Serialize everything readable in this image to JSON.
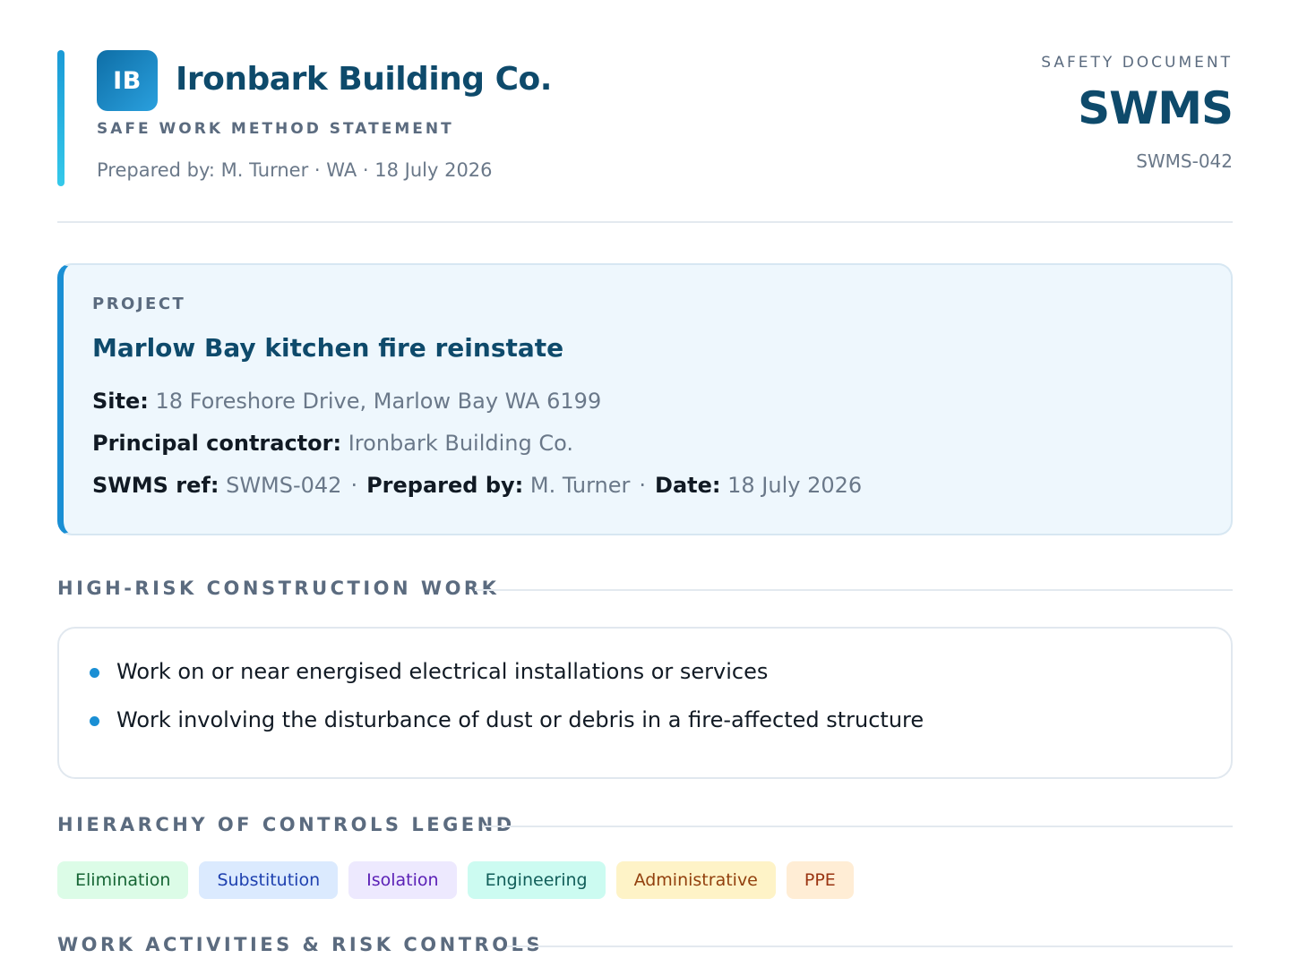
{
  "header": {
    "logo_text": "IB",
    "company_name": "Ironbark Building Co.",
    "subtitle": "SAFE WORK METHOD STATEMENT",
    "prepared_line": "Prepared by: M. Turner · WA · 18 July 2026",
    "doc_type_label": "SAFETY DOCUMENT",
    "doc_type": "SWMS",
    "doc_ref": "SWMS-042"
  },
  "project": {
    "label": "PROJECT",
    "title": "Marlow Bay kitchen fire reinstate",
    "site_label": "Site:",
    "site": "18 Foreshore Drive, Marlow Bay WA 6199",
    "contractor_label": "Principal contractor:",
    "contractor": "Ironbark Building Co.",
    "ref_label": "SWMS ref:",
    "ref": "SWMS-042",
    "prepared_label": "Prepared by:",
    "prepared": "M. Turner",
    "date_label": "Date:",
    "date": "18 July 2026",
    "separator": "·"
  },
  "sections": {
    "hrcw_title": "HIGH-RISK CONSTRUCTION WORK",
    "legend_title": "HIERARCHY OF CONTROLS LEGEND",
    "activities_title": "WORK ACTIVITIES & RISK CONTROLS"
  },
  "hrcw_items": [
    "Work on or near energised electrical installations or services",
    "Work involving the disturbance of dust or debris in a fire-affected structure"
  ],
  "legend": [
    {
      "label": "Elimination",
      "bg": "#dcfce7",
      "fg": "#166534"
    },
    {
      "label": "Substitution",
      "bg": "#dbeafe",
      "fg": "#1e40af"
    },
    {
      "label": "Isolation",
      "bg": "#ede9fe",
      "fg": "#5b21b6"
    },
    {
      "label": "Engineering",
      "bg": "#ccfbf1",
      "fg": "#115e59"
    },
    {
      "label": "Administrative",
      "bg": "#fef3c7",
      "fg": "#92400e"
    },
    {
      "label": "PPE",
      "bg": "#ffedd5",
      "fg": "#9a3412"
    }
  ],
  "colors": {
    "accent": "#1a8fd4",
    "brand_dark": "#0e4a6b"
  }
}
